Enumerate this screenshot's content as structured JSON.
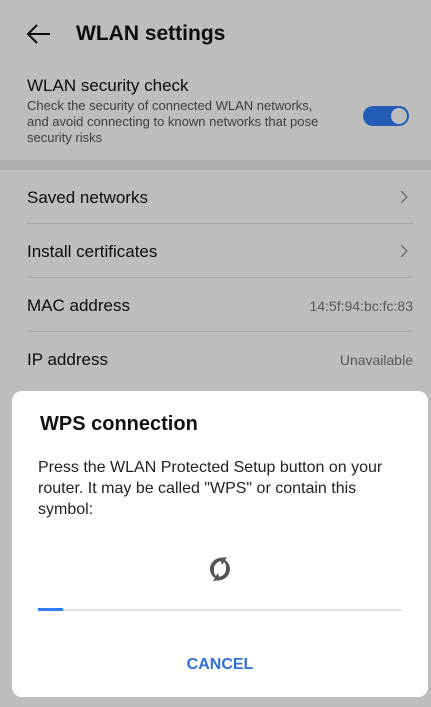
{
  "appbar": {
    "title": "WLAN settings"
  },
  "security": {
    "title": "WLAN security check",
    "description": "Check the security of connected WLAN networks, and avoid connecting to known networks that pose security risks",
    "enabled": true
  },
  "list": [
    {
      "label": "Saved networks",
      "value": "",
      "icon": "chevron-right-icon"
    },
    {
      "label": "Install certificates",
      "value": "",
      "icon": "chevron-right-icon"
    },
    {
      "label": "MAC address",
      "value": "14:5f:94:bc:fc:83"
    },
    {
      "label": "IP address",
      "value": "Unavailable"
    }
  ],
  "dialog": {
    "title": "WPS connection",
    "message": "Press the WLAN Protected Setup button on your router. It may be called \"WPS\" or contain this symbol:",
    "icon": "wps-icon",
    "progress": 0.07,
    "cancel_label": "CANCEL"
  },
  "colors": {
    "accent": "#2f7cf6",
    "cancel": "#2f6fd6"
  }
}
